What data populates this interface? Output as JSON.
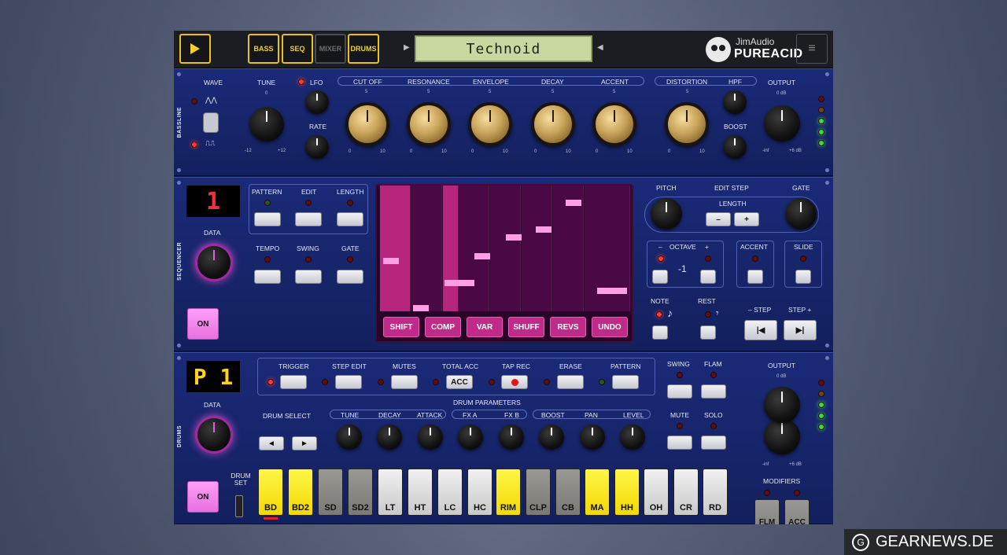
{
  "toolbar": {
    "tabs": [
      {
        "label": "BASS",
        "active": true
      },
      {
        "label": "SEQ",
        "active": true
      },
      {
        "label": "MIXER",
        "active": false
      },
      {
        "label": "DRUMS",
        "active": true
      }
    ],
    "display_text": "Technoid",
    "brand_top": "JimAudio",
    "brand_bottom": "PUREACID",
    "menu_icon": "hamburger-icon"
  },
  "bassline": {
    "side_label": "BASSLINE",
    "wave_label": "WAVE",
    "wave_saw": "⋀⋀",
    "wave_square": "⎍⎍",
    "tune_label": "TUNE",
    "tune_ticks": [
      "0",
      "-12",
      "+12"
    ],
    "lfo_label": "LFO",
    "rate_label": "RATE",
    "filter_knobs": [
      {
        "label": "CUT OFF"
      },
      {
        "label": "RESONANCE"
      },
      {
        "label": "ENVELOPE"
      },
      {
        "label": "DECAY"
      },
      {
        "label": "ACCENT"
      }
    ],
    "scale_top": "5",
    "scale_left": "0",
    "scale_right": "10",
    "distortion_label": "DISTORTION",
    "hpf_label": "HPF",
    "boost_label": "BOOST",
    "output_label": "OUTPUT",
    "output_ticks": [
      "0 dB",
      "-inf",
      "+6 dB"
    ]
  },
  "sequencer": {
    "side_label": "SEQUENCER",
    "pattern_number": "1",
    "data_label": "DATA",
    "on_label": "ON",
    "pattern_label": "PATTERN",
    "edit_label": "EDIT",
    "length_label": "LENGTH",
    "tempo_label": "TEMPO",
    "swing_label": "SWING",
    "gate_label": "GATE",
    "roll_buttons": [
      "SHIFT",
      "COMP",
      "VAR",
      "SHUFF",
      "REVS",
      "UNDO"
    ],
    "pitch_label": "PITCH",
    "edit_step_label": "EDIT STEP",
    "step_gate_label": "GATE",
    "step_length_label": "LENGTH",
    "minus": "–",
    "plus": "+",
    "octave_minus": "–",
    "octave_label": "OCTAVE",
    "octave_plus": "+",
    "octave_value": "-1",
    "accent_label": "ACCENT",
    "slide_label": "SLIDE",
    "note_label": "NOTE",
    "rest_label": "REST",
    "step_minus_label": "– STEP",
    "step_plus_label": "STEP +"
  },
  "drums": {
    "side_label": "DRUMS",
    "pattern_display": "P 1",
    "data_label": "DATA",
    "on_label": "ON",
    "drum_set_label": "DRUM SET",
    "row_labels": [
      "TRIGGER",
      "STEP EDIT",
      "MUTES",
      "TOTAL ACC",
      "TAP REC",
      "ERASE",
      "PATTERN"
    ],
    "acc_button": "ACC",
    "swing_label": "SWING",
    "flam_label": "FLAM",
    "mute_label": "MUTE",
    "solo_label": "SOLO",
    "output_label": "OUTPUT",
    "output_ticks": [
      "0 dB",
      "-inf",
      "+6 dB"
    ],
    "params_title": "DRUM PARAMETERS",
    "drum_select_label": "DRUM  SELECT",
    "param_labels": [
      "TUNE",
      "DECAY",
      "ATTACK",
      "FX A",
      "FX B",
      "BOOST",
      "PAN",
      "LEVEL"
    ],
    "modifiers_label": "MODIFIERS",
    "modifier_buttons": [
      "FLM",
      "ACC"
    ],
    "pads": [
      {
        "label": "BD",
        "color": "yellow"
      },
      {
        "label": "BD2",
        "color": "yellow"
      },
      {
        "label": "SD",
        "color": "grey"
      },
      {
        "label": "SD2",
        "color": "grey"
      },
      {
        "label": "LT",
        "color": "white"
      },
      {
        "label": "HT",
        "color": "white"
      },
      {
        "label": "LC",
        "color": "white"
      },
      {
        "label": "HC",
        "color": "white"
      },
      {
        "label": "RIM",
        "color": "yellow"
      },
      {
        "label": "CLP",
        "color": "grey"
      },
      {
        "label": "CB",
        "color": "grey"
      },
      {
        "label": "MA",
        "color": "yellow"
      },
      {
        "label": "HH",
        "color": "yellow"
      },
      {
        "label": "OH",
        "color": "white"
      },
      {
        "label": "CR",
        "color": "white"
      },
      {
        "label": "RD",
        "color": "white"
      }
    ]
  },
  "watermark": {
    "icon": "G",
    "text": "GEARNEWS.DE"
  },
  "colors": {
    "accent_yellow": "#f2d029",
    "pink": "#e86fe0",
    "panel_blue": "#1b2a78"
  }
}
